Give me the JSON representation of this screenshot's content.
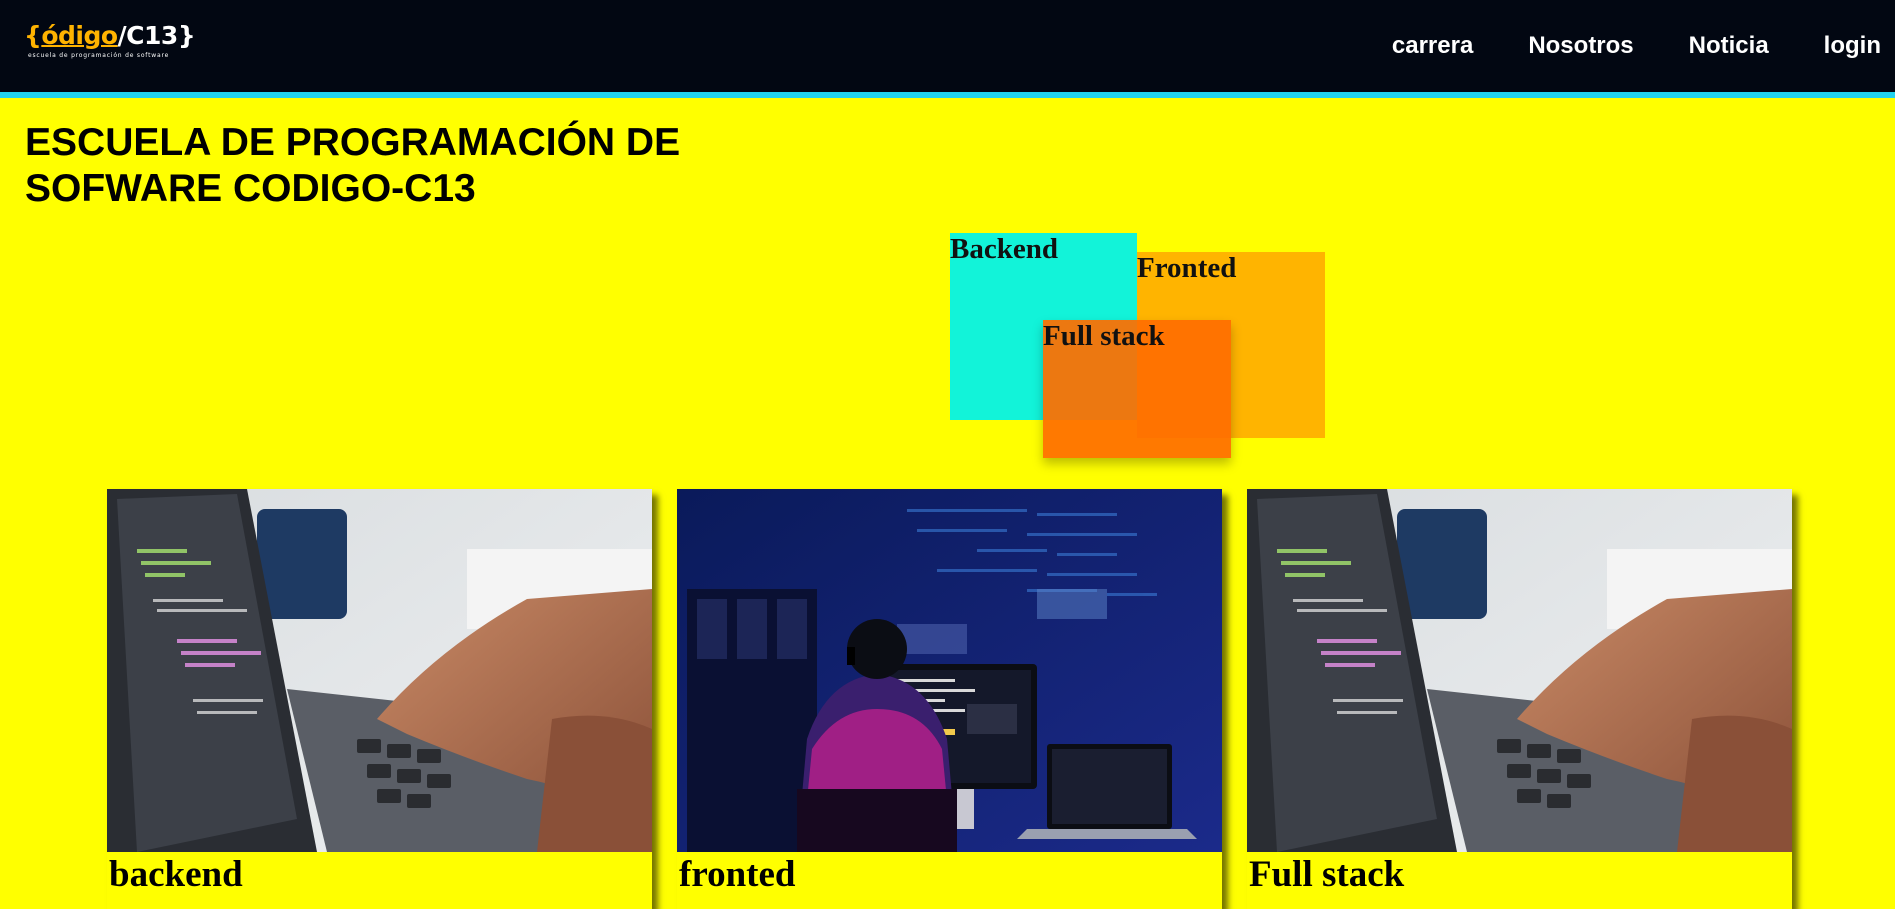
{
  "header": {
    "logo": {
      "brace_open": "{",
      "word": "ódigo",
      "separator": "/",
      "code": "C13",
      "brace_close": "}",
      "tagline": "escuela de programación de software"
    },
    "nav": [
      {
        "label": "carrera"
      },
      {
        "label": "Nosotros"
      },
      {
        "label": "Noticia"
      },
      {
        "label": "login"
      }
    ]
  },
  "main": {
    "title": "ESCUELA DE PROGRAMACIÓN DE SOFWARE CODIGO-C13",
    "boxes": {
      "backend": "Backend",
      "fronted": "Fronted",
      "fullstack": "Full stack"
    },
    "cards": [
      {
        "title": "backend"
      },
      {
        "title": "fronted"
      },
      {
        "title": "Full stack"
      }
    ]
  },
  "colors": {
    "page_background": "#ffff00",
    "header_background": "#020712",
    "header_border": "#22d3ee",
    "logo_accent": "#ffb300",
    "box_backend": "#12f3d9",
    "box_fronted": "#ffb400",
    "box_fullstack": "#ff6e00"
  }
}
